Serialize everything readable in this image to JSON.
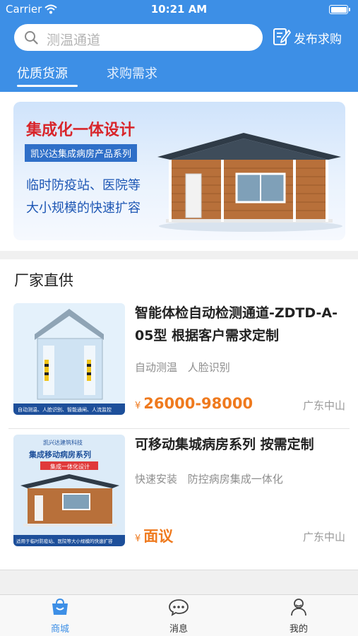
{
  "status_bar": {
    "carrier": "Carrier",
    "time": "10:21 AM"
  },
  "header": {
    "search_placeholder": "测温通道",
    "publish_label": "发布求购",
    "tabs": [
      {
        "label": "优质货源"
      },
      {
        "label": "求购需求"
      }
    ]
  },
  "banner": {
    "title": "集成化一体设计",
    "tag": "凯兴达集成病房产品系列",
    "line1": "临时防疫站、医院等",
    "line2": "大小规模的快速扩容"
  },
  "section": {
    "title": "厂家直供",
    "products": [
      {
        "name": "智能体检自动检测通道-ZDTD-A-05型 根据客户需求定制",
        "tags": [
          "自动测温",
          "人脸识别"
        ],
        "currency": "¥",
        "price": "26000-98000",
        "location": "广东中山"
      },
      {
        "name": "可移动集城病房系列 按需定制",
        "tags": [
          "快速安装",
          "防控病房集成一体化"
        ],
        "currency": "¥",
        "price": "面议",
        "location": "广东中山"
      }
    ]
  },
  "tabbar": {
    "items": [
      {
        "label": "商城"
      },
      {
        "label": "消息"
      },
      {
        "label": "我的"
      }
    ]
  },
  "colors": {
    "primary": "#3d8fe6",
    "price": "#ef7a1e",
    "banner_title": "#d8252a"
  },
  "icons": [
    "wifi-icon",
    "battery-icon",
    "search-icon",
    "edit-icon",
    "shop-bag-icon",
    "chat-icon",
    "user-icon"
  ]
}
